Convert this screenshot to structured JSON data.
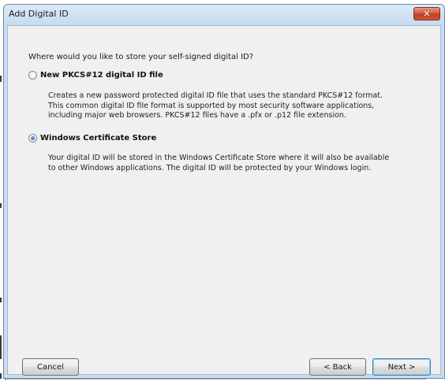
{
  "window": {
    "title": "Add Digital ID",
    "close_symbol": "✕",
    "close_icon": "close-icon"
  },
  "main": {
    "question": "Where would you like to store your self-signed digital ID?",
    "options": [
      {
        "label": "New PKCS#12 digital ID file",
        "selected": false,
        "description": [
          "Creates a new password protected digital ID file that uses the standard PKCS#12 format.",
          "This common digital ID file format is supported by most security software applications,",
          "including major web browsers. PKCS#12 files have a .pfx or .p12 file extension."
        ]
      },
      {
        "label": "Windows Certificate Store",
        "selected": true,
        "description": [
          "Your digital ID will be stored in the Windows Certificate Store where it will also be available",
          "to other Windows applications. The digital ID will be protected by your Windows login."
        ]
      }
    ]
  },
  "footer": {
    "cancel_label": "Cancel",
    "back_label": "< Back",
    "next_label": "Next >"
  },
  "colors": {
    "title_bar": "#c9dcf0",
    "close_button": "#c33c22",
    "client_background": "#f0f0f0",
    "radio_selected": "#1a5fc4"
  }
}
